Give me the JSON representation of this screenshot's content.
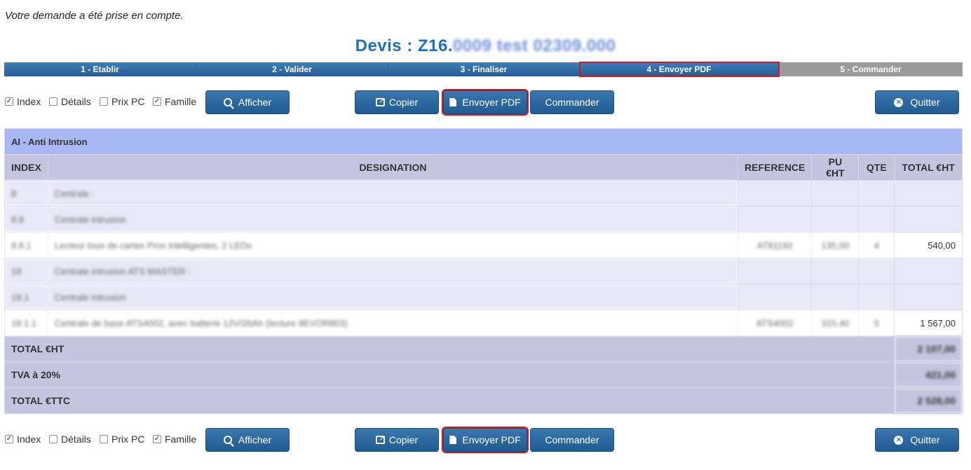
{
  "notice": "Votre demande a été prise en compte.",
  "title": {
    "prefix": "Devis : Z16.",
    "blurred_suffix": "0009 test 02309.000"
  },
  "steps": [
    {
      "label": "1 - Etablir"
    },
    {
      "label": "2 - Valider"
    },
    {
      "label": "3 - Finaliser"
    },
    {
      "label": "4 - Envoyer PDF"
    },
    {
      "label": "5 - Commander"
    }
  ],
  "toolbar": {
    "checkboxes": [
      {
        "label": "Index",
        "checked": true
      },
      {
        "label": "Détails",
        "checked": false
      },
      {
        "label": "Prix PC",
        "checked": false
      },
      {
        "label": "Famille",
        "checked": true
      }
    ],
    "afficher": "Afficher",
    "copier": "Copier",
    "envoyer_pdf": "Envoyer PDF",
    "commander": "Commander",
    "quitter": "Quitter"
  },
  "table": {
    "group": "AI - Anti Intrusion",
    "headers": {
      "index": "INDEX",
      "designation": "DESIGNATION",
      "reference": "REFERENCE",
      "pu": "PU €HT",
      "qte": "QTE",
      "total": "TOTAL €HT"
    },
    "rows": [
      {
        "type": "sec",
        "index": "8",
        "designation": "Centrale :",
        "reference": "",
        "pu": "",
        "qte": "",
        "total": ""
      },
      {
        "type": "sec",
        "index": "8.8",
        "designation": "Centrale intrusion",
        "reference": "",
        "pu": "",
        "qte": "",
        "total": ""
      },
      {
        "type": "item",
        "index": "8.8.1",
        "designation": "Lecteur tous de cartes Prox intelligentes, 2 LEDs",
        "reference": "AT81192",
        "pu": "135,00",
        "qte": "4",
        "total": "540,00"
      },
      {
        "type": "sec",
        "index": "18",
        "designation": "Centrale intrusion ATS MASTER :",
        "reference": "",
        "pu": "",
        "qte": "",
        "total": ""
      },
      {
        "type": "sec",
        "index": "18.1",
        "designation": "Centrale intrusion",
        "reference": "",
        "pu": "",
        "qte": "",
        "total": ""
      },
      {
        "type": "item",
        "index": "18.1.1",
        "designation": "Centrale de base ATS4002, avec batterie 12V/26Ah (lecture 8EVOR803)",
        "reference": "ATS4002",
        "pu": "315,40",
        "qte": "5",
        "total": "1 567,00"
      }
    ],
    "totals": [
      {
        "label": "TOTAL €HT",
        "value": "2 107,00"
      },
      {
        "label": "TVA à 20%",
        "value": "421,00"
      },
      {
        "label": "TOTAL €TTC",
        "value": "2 528,00"
      }
    ]
  }
}
